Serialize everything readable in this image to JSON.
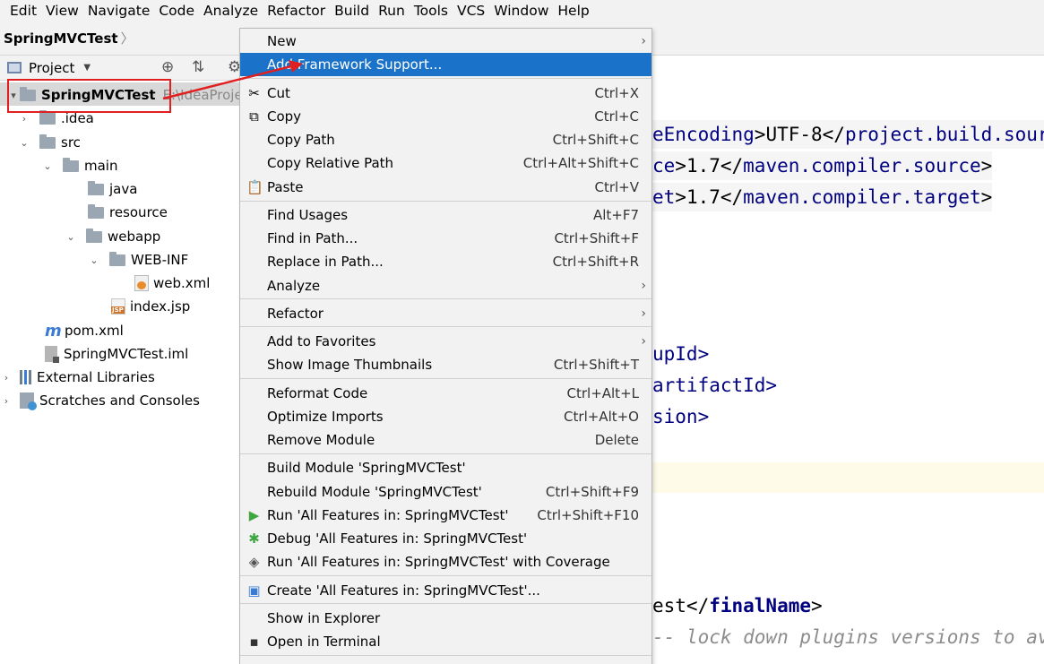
{
  "menubar": [
    "Edit",
    "View",
    "Navigate",
    "Code",
    "Analyze",
    "Refactor",
    "Build",
    "Run",
    "Tools",
    "VCS",
    "Window",
    "Help"
  ],
  "breadcrumb": "SpringMVCTest",
  "project_panel": {
    "title": "Project"
  },
  "tree": {
    "root": "SpringMVCTest",
    "root_path": "E:\\IdeaProject",
    "idea": ".idea",
    "src": "src",
    "main": "main",
    "java": "java",
    "resource": "resource",
    "webapp": "webapp",
    "webinf": "WEB-INF",
    "webxml": "web.xml",
    "indexjsp": "index.jsp",
    "pom": "pom.xml",
    "iml": "SpringMVCTest.iml",
    "extlib": "External Libraries",
    "scratches": "Scratches and Consoles"
  },
  "editor": {
    "l1a": "eEncoding",
    "l1b": ">UTF-8</",
    "l1c": "project.build.sour",
    "l2a": "ce",
    "l2b": ">1.7</",
    "l2c": "maven.compiler.source",
    "l2d": ">",
    "l3a": "et",
    "l3b": ">1.7</",
    "l3c": "maven.compiler.target",
    "l3d": ">",
    "l4": "upId>",
    "l5": "artifactId>",
    "l6": "sion>",
    "l7a": "est</",
    "l7b": "finalName",
    "l7c": ">",
    "l8": "-- lock down plugins versions to avoi"
  },
  "menu": {
    "new": "New",
    "add_framework": "Add Framework Support...",
    "cut": "Cut",
    "cut_sc": "Ctrl+X",
    "copy": "Copy",
    "copy_sc": "Ctrl+C",
    "copy_path": "Copy Path",
    "copy_path_sc": "Ctrl+Shift+C",
    "copy_rel": "Copy Relative Path",
    "copy_rel_sc": "Ctrl+Alt+Shift+C",
    "paste": "Paste",
    "paste_sc": "Ctrl+V",
    "find_usages": "Find Usages",
    "find_usages_sc": "Alt+F7",
    "find_path": "Find in Path...",
    "find_path_sc": "Ctrl+Shift+F",
    "replace_path": "Replace in Path...",
    "replace_path_sc": "Ctrl+Shift+R",
    "analyze": "Analyze",
    "refactor": "Refactor",
    "add_fav": "Add to Favorites",
    "show_thumbs": "Show Image Thumbnails",
    "show_thumbs_sc": "Ctrl+Shift+T",
    "reformat": "Reformat Code",
    "reformat_sc": "Ctrl+Alt+L",
    "optimize": "Optimize Imports",
    "optimize_sc": "Ctrl+Alt+O",
    "remove_module": "Remove Module",
    "remove_module_sc": "Delete",
    "build_module": "Build Module 'SpringMVCTest'",
    "rebuild_module": "Rebuild Module 'SpringMVCTest'",
    "rebuild_module_sc": "Ctrl+Shift+F9",
    "run_all": "Run 'All Features in: SpringMVCTest'",
    "run_all_sc": "Ctrl+Shift+F10",
    "debug_all": "Debug 'All Features in: SpringMVCTest'",
    "run_cov": "Run 'All Features in: SpringMVCTest' with Coverage",
    "create_all": "Create 'All Features in: SpringMVCTest'...",
    "show_explorer": "Show in Explorer",
    "open_terminal": "Open in Terminal"
  },
  "colors": {
    "menu_highlight": "#1b73c9",
    "annotation": "#e02020",
    "run_green": "#3ea63e"
  }
}
